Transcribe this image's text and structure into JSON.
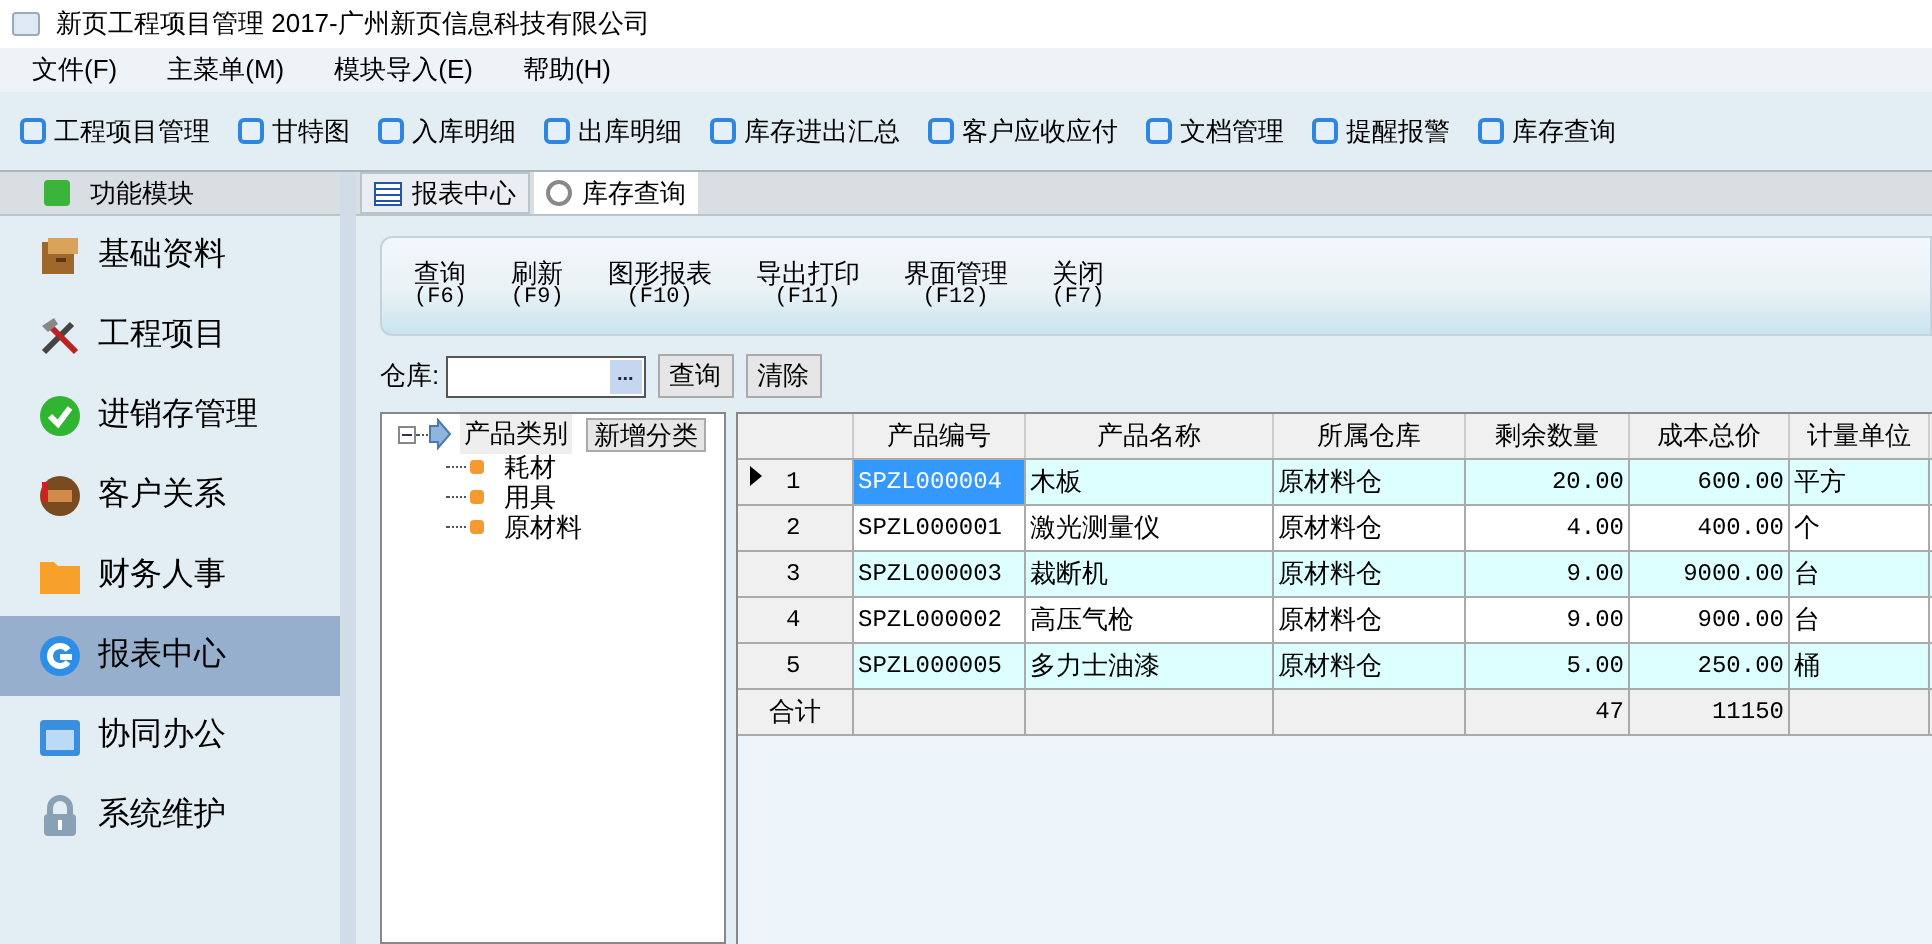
{
  "window": {
    "title": "新页工程项目管理 2017-广州新页信息科技有限公司"
  },
  "menu": [
    "文件(F)",
    "主菜单(M)",
    "模块导入(E)",
    "帮助(H)"
  ],
  "toolbar": [
    "工程项目管理",
    "甘特图",
    "入库明细",
    "出库明细",
    "库存进出汇总",
    "客户应收应付",
    "文档管理",
    "提醒报警",
    "库存查询"
  ],
  "sidebar": {
    "title": "功能模块",
    "items": [
      {
        "label": "基础资料",
        "selected": false
      },
      {
        "label": "工程项目",
        "selected": false
      },
      {
        "label": "进销存管理",
        "selected": false
      },
      {
        "label": "客户关系",
        "selected": false
      },
      {
        "label": "财务人事",
        "selected": false
      },
      {
        "label": "报表中心",
        "selected": true
      },
      {
        "label": "协同办公",
        "selected": false
      },
      {
        "label": "系统维护",
        "selected": false
      }
    ]
  },
  "tabs": [
    {
      "label": "报表中心",
      "selected": false
    },
    {
      "label": "库存查询",
      "selected": true
    }
  ],
  "actions": [
    {
      "label": "查询",
      "key": "(F6)"
    },
    {
      "label": "刷新",
      "key": "(F9)"
    },
    {
      "label": "图形报表",
      "key": "(F10)"
    },
    {
      "label": "导出打印",
      "key": "(F11)"
    },
    {
      "label": "界面管理",
      "key": "(F12)"
    },
    {
      "label": "关闭",
      "key": "(F7)"
    }
  ],
  "filter": {
    "label": "仓库:",
    "picker": "...",
    "buttons": [
      "查询",
      "清除"
    ]
  },
  "tree": {
    "label": "产品类别",
    "selected": true,
    "expanded": true,
    "add_button": "新增分类",
    "children": [
      {
        "label": "耗材",
        "selected": false
      },
      {
        "label": "用具",
        "selected": false
      },
      {
        "label": "原材料",
        "selected": false
      }
    ]
  },
  "table": {
    "columns": [
      "产品编号",
      "产品名称",
      "所属仓库",
      "剩余数量",
      "成本总价",
      "计量单位"
    ],
    "rows": [
      {
        "index": "1",
        "selected": true,
        "cells": [
          "SPZL000004",
          "木板",
          "原材料仓",
          "20.00",
          "600.00",
          "平方"
        ]
      },
      {
        "index": "2",
        "selected": false,
        "cells": [
          "SPZL000001",
          "激光测量仪",
          "原材料仓",
          "4.00",
          "400.00",
          "个"
        ]
      },
      {
        "index": "3",
        "selected": false,
        "cells": [
          "SPZL000003",
          "裁断机",
          "原材料仓",
          "9.00",
          "9000.00",
          "台"
        ]
      },
      {
        "index": "4",
        "selected": false,
        "cells": [
          "SPZL000002",
          "高压气枪",
          "原材料仓",
          "9.00",
          "900.00",
          "台"
        ]
      },
      {
        "index": "5",
        "selected": false,
        "cells": [
          "SPZL000005",
          "多力士油漆",
          "原材料仓",
          "5.00",
          "250.00",
          "桶"
        ]
      }
    ],
    "total": {
      "label": "合计",
      "quantity": "47",
      "cost": "11150"
    }
  }
}
